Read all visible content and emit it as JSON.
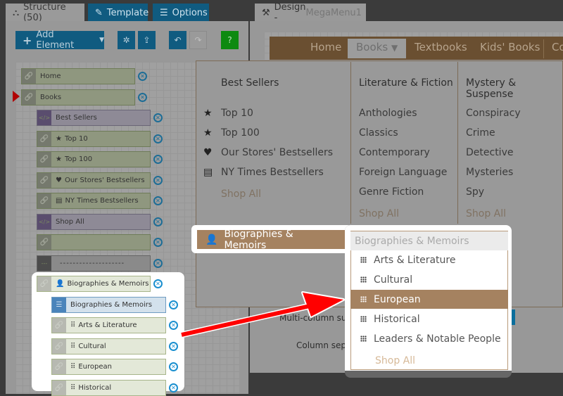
{
  "left_tabs": [
    {
      "label": "Structure (50)",
      "icon": "sitemap-icon"
    },
    {
      "label": "Template",
      "icon": "brush-icon"
    },
    {
      "label": "Options",
      "icon": "list-icon"
    }
  ],
  "toolbar": {
    "add_element": "Add Element",
    "buttons": [
      "magic-wand-icon",
      "export-icon",
      "undo-icon",
      "redo-icon",
      "help-icon"
    ]
  },
  "tree": [
    {
      "label": "Home",
      "type": "link",
      "level": 0
    },
    {
      "label": "Books",
      "type": "link",
      "level": 0,
      "selected": true
    },
    {
      "label": "Best Sellers",
      "type": "code",
      "level": 1
    },
    {
      "label": "Top 10",
      "type": "link",
      "level": 1,
      "icon": "★"
    },
    {
      "label": "Top 100",
      "type": "link",
      "level": 1,
      "icon": "★"
    },
    {
      "label": "Our Stores' Bestsellers",
      "type": "link",
      "level": 1,
      "icon": "♥"
    },
    {
      "label": "NY Times Bestsellers",
      "type": "link",
      "level": 1,
      "icon": "▤"
    },
    {
      "label": "Shop All",
      "type": "code",
      "level": 1
    },
    {
      "label": "",
      "type": "link",
      "level": 1
    },
    {
      "label": "--------------------",
      "type": "separator",
      "level": 1
    },
    {
      "label": "Biographies & Memoirs",
      "type": "link",
      "level": 1,
      "icon": "👤"
    },
    {
      "label": "Biographies & Memoirs",
      "type": "heading",
      "level": 2
    },
    {
      "label": "Arts & Literature",
      "type": "link",
      "level": 2,
      "icon": "⠿"
    },
    {
      "label": "Cultural",
      "type": "link",
      "level": 2,
      "icon": "⠿"
    },
    {
      "label": "European",
      "type": "link",
      "level": 2,
      "icon": "⠿"
    },
    {
      "label": "Historical",
      "type": "link",
      "level": 2,
      "icon": "⠿"
    }
  ],
  "design_tab": {
    "label": "Design - ",
    "name": "MegaMenu1"
  },
  "nav": [
    "Home",
    "Books",
    "Textbooks",
    "Kids' Books",
    "Co"
  ],
  "columns": [
    {
      "heading": "Best Sellers",
      "items": [
        "Top 10",
        "Top 100",
        "Our Stores' Bestsellers",
        "NY Times Bestsellers"
      ],
      "shop": "Shop All"
    },
    {
      "heading": "Literature & Fiction",
      "items": [
        "Anthologies",
        "Classics",
        "Contemporary",
        "Foreign Language",
        "Genre Fiction"
      ],
      "shop": "Shop All"
    },
    {
      "heading": "Mystery & Suspense",
      "items": [
        "Conspiracy",
        "Crime",
        "Detective",
        "Mysteries",
        "Spy"
      ],
      "shop": "Shop All"
    }
  ],
  "bio_item": "Biographies & Memoirs",
  "submenu": {
    "heading": "Biographies & Memoirs",
    "items": [
      "Arts & Literature",
      "Cultural",
      "European",
      "Historical",
      "Leaders & Notable People"
    ],
    "active": "European",
    "shop": "Shop All"
  },
  "options": {
    "multi": "Multi-column subm",
    "colsep": "Column separ"
  },
  "colors": {
    "brand_brown": "#a58260",
    "accent_blue": "#1a8fcf",
    "link_green": "#7a9550"
  }
}
